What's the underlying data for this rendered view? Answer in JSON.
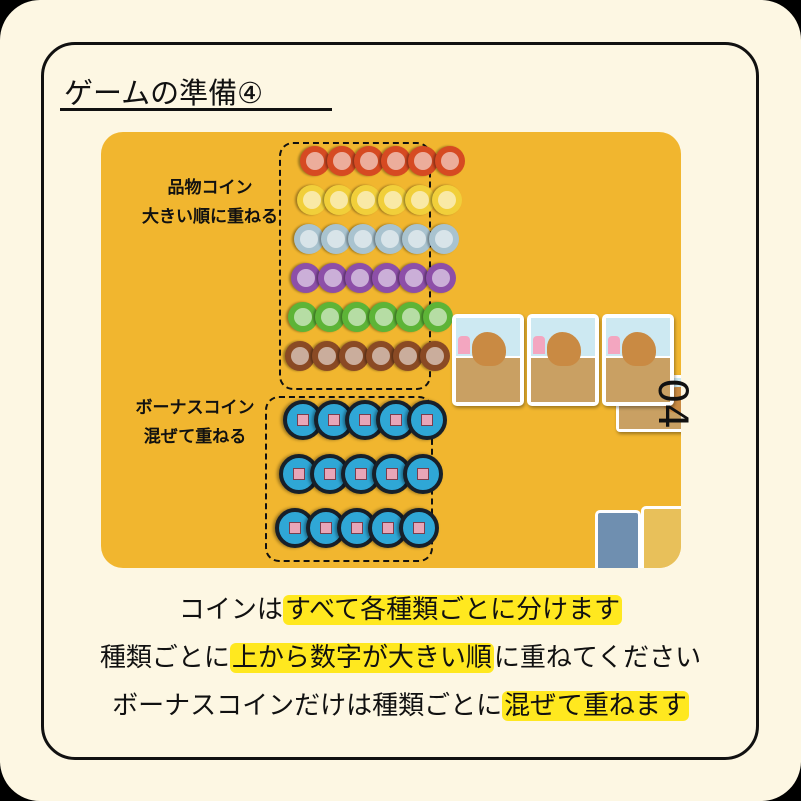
{
  "title": "ゲームの準備④",
  "labels": {
    "goods_line1": "品物コイン",
    "goods_line2": "大きい順に重ねる",
    "bonus_line1": "ボーナスコイン",
    "bonus_line2": "混ぜて重ねる"
  },
  "page_number": "04",
  "coin_colors": [
    "#d64a22",
    "#f1cf3a",
    "#a9c3cf",
    "#8d4fa8",
    "#5db437",
    "#8a4a24"
  ],
  "coins_per_row": 6,
  "bonus_rows": 3,
  "bonus_per_row": 5,
  "captions": [
    {
      "before": "コインは",
      "highlight": "すべて各種類ごとに分けます",
      "after": ""
    },
    {
      "before": "種類ごとに",
      "highlight": "上から数字が大きい順",
      "after": "に重ねてください"
    },
    {
      "before": "ボーナスコインだけは種類ごとに",
      "highlight": "混ぜて重ねます",
      "after": ""
    }
  ],
  "colors": {
    "background": "#fdf7e3",
    "table": "#f1b62f",
    "highlight": "#ffe81f",
    "bonus_coin": "#2fa7d6"
  }
}
